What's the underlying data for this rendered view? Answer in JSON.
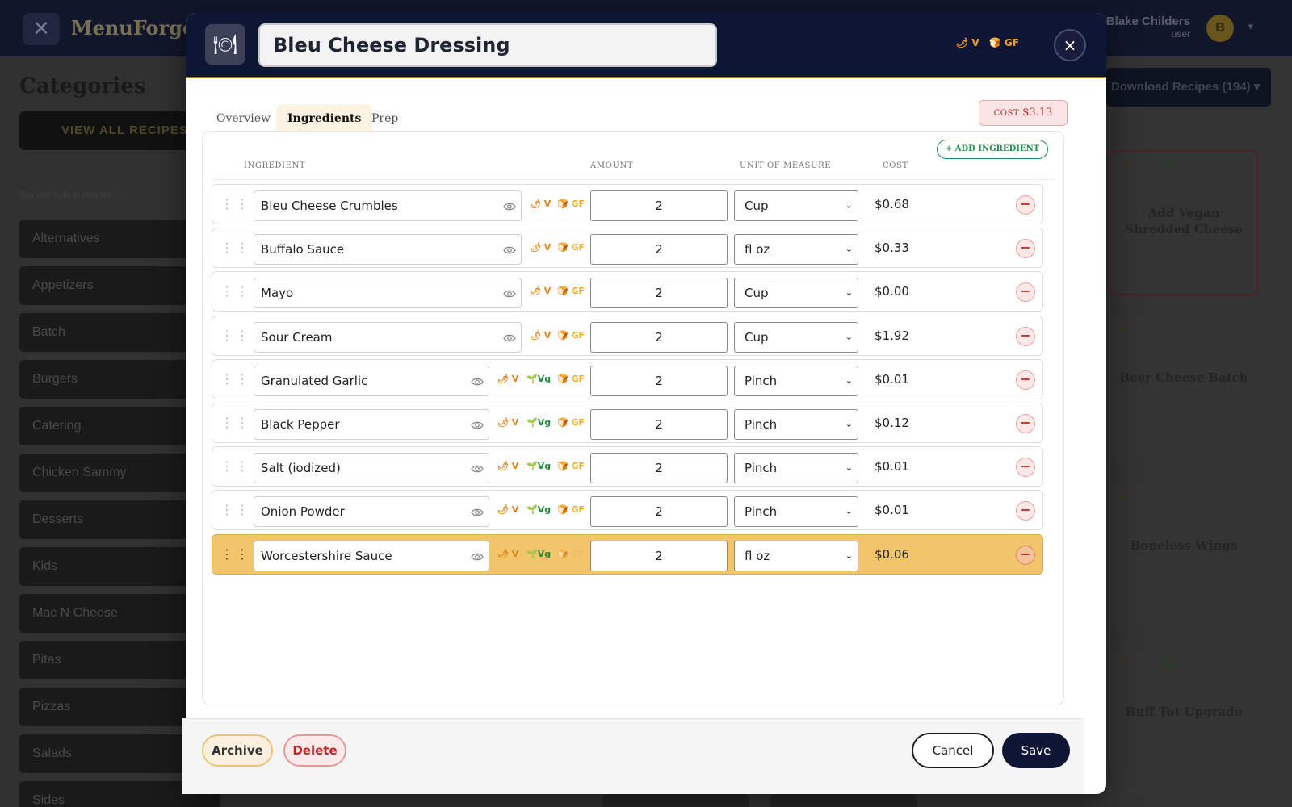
{
  "app": {
    "logo_text": "MenuForge.",
    "user_name": "Blake Childers",
    "user_role": "user",
    "avatar_initial": "B"
  },
  "sidebar": {
    "title": "Categories",
    "view_all_label": "VIEW ALL RECIPES",
    "drag_hint": "Tap and hold to reorder ...",
    "items": [
      {
        "label": "Alternatives"
      },
      {
        "label": "Appetizers"
      },
      {
        "label": "Batch"
      },
      {
        "label": "Burgers"
      },
      {
        "label": "Catering"
      },
      {
        "label": "Chicken Sammy"
      },
      {
        "label": "Desserts"
      },
      {
        "label": "Kids"
      },
      {
        "label": "Mac N Cheese"
      },
      {
        "label": "Pitas"
      },
      {
        "label": "Pizzas"
      },
      {
        "label": "Salads"
      },
      {
        "label": "Sides"
      }
    ]
  },
  "main": {
    "download_label": "Download Recipes (194) ▾",
    "cards": [
      {
        "title": "Add Vegan Shredded Cheese",
        "tag_v": "V",
        "tag_vg": "Vg"
      },
      {
        "title": "Beer Cheese Batch",
        "tag_v": "V"
      },
      {
        "title": "Boneless Wings",
        "tag_v": "V"
      },
      {
        "title": "Buff Tot Upgrade",
        "tag_v": "V",
        "tag_vg": "Vg"
      }
    ]
  },
  "modal": {
    "recipe_name": "Bleu Cheese Dressing",
    "header_tags": {
      "v": "V",
      "gf": "GF"
    },
    "close_label": "×",
    "tabs": [
      {
        "label": "Overview"
      },
      {
        "label": "Ingredients"
      },
      {
        "label": "Prep"
      }
    ],
    "active_tab": "Ingredients",
    "cost_label": "COST",
    "cost_value": "$3.13",
    "add_ingredient_label": "ADD INGREDIENT",
    "columns": {
      "ingredient": "INGREDIENT",
      "amount": "AMOUNT",
      "unit": "UNIT OF MEASURE",
      "cost": "COST"
    },
    "tag_labels": {
      "v": "V",
      "vg": "Vg",
      "gf": "GF"
    },
    "ingredients": [
      {
        "name": "Bleu Cheese Crumbles",
        "amount": "2",
        "unit": "Cup",
        "cost": "$0.68",
        "vegan": false
      },
      {
        "name": "Buffalo Sauce",
        "amount": "2",
        "unit": "fl oz",
        "cost": "$0.33",
        "vegan": false
      },
      {
        "name": "Mayo",
        "amount": "2",
        "unit": "Cup",
        "cost": "$0.00",
        "vegan": false
      },
      {
        "name": "Sour Cream",
        "amount": "2",
        "unit": "Cup",
        "cost": "$1.92",
        "vegan": false
      },
      {
        "name": "Granulated Garlic",
        "amount": "2",
        "unit": "Pinch",
        "cost": "$0.01",
        "vegan": true
      },
      {
        "name": "Black Pepper",
        "amount": "2",
        "unit": "Pinch",
        "cost": "$0.12",
        "vegan": true
      },
      {
        "name": "Salt (iodized)",
        "amount": "2",
        "unit": "Pinch",
        "cost": "$0.01",
        "vegan": true
      },
      {
        "name": "Onion Powder",
        "amount": "2",
        "unit": "Pinch",
        "cost": "$0.01",
        "vegan": true
      },
      {
        "name": "Worcestershire Sauce",
        "amount": "2",
        "unit": "fl oz",
        "cost": "$0.06",
        "vegan": true,
        "highlighted": true
      }
    ],
    "footer": {
      "archive_label": "Archive",
      "delete_label": "Delete",
      "cancel_label": "Cancel",
      "save_label": "Save"
    }
  },
  "colors": {
    "navy": "#0f1535",
    "gold_accent": "#9b7c2a",
    "highlight_row": "#f2c46b",
    "vegetarian_tag": "#e6831a",
    "vegan_tag": "#1f8a3a",
    "gluten_free_tag": "#ebaa2a",
    "danger": "#c22424",
    "success": "#1f8f4e"
  }
}
